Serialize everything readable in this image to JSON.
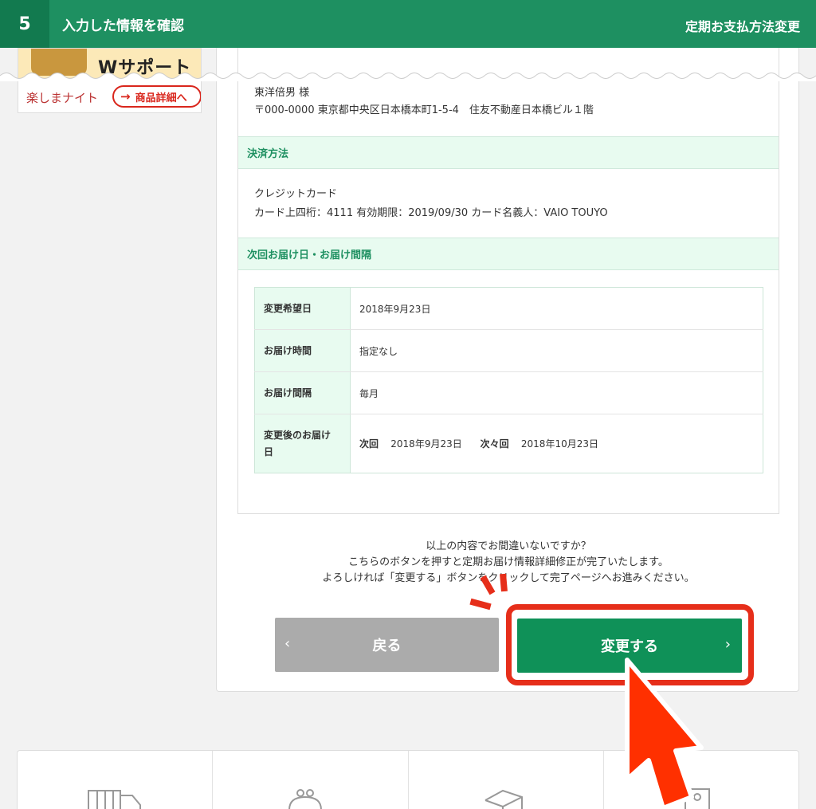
{
  "header": {
    "step_number": "5",
    "step_title": "入力した情報を確認",
    "right_title": "定期お支払方法変更"
  },
  "banner": {
    "headline": "Wサポート",
    "brand": "楽しまナイト",
    "link_label": "商品詳細へ"
  },
  "delivery_address": {
    "name": "東洋倍男 様",
    "address": "〒000-0000 東京都中央区日本橋本町1-5-4　住友不動産日本橋ビル１階"
  },
  "payment": {
    "section_title": "決済方法",
    "method": "クレジットカード",
    "card_info": "カード上四桁：4111 有効期限：2019/09/30 カード名義人：VAIO TOUYO"
  },
  "schedule": {
    "section_title": "次回お届け日・お届け間隔",
    "rows": [
      {
        "label": "変更希望日",
        "value": "2018年9月23日"
      },
      {
        "label": "お届け時間",
        "value": "指定なし"
      },
      {
        "label": "お届け間隔",
        "value": "毎月"
      }
    ],
    "after_change": {
      "label_line1": "変更後のお届け",
      "label_line2": "日",
      "next_label": "次回",
      "next_date": "2018年9月23日",
      "after_next_label": "次々回",
      "after_next_date": "2018年10月23日"
    }
  },
  "confirm": {
    "line1": "以上の内容でお間違いないですか？",
    "line2": "こちらのボタンを押すと定期お届け情報詳細修正が完了いたします。",
    "line3": "よろしければ「変更する」ボタンをクリックして完了ページへお進みください。"
  },
  "buttons": {
    "back_label": "戻る",
    "back_chevron": "‹",
    "submit_label": "変更する",
    "submit_chevron": "›"
  },
  "bottom_nav": {
    "icons": [
      "truck-icon",
      "purse-icon",
      "box-icon",
      "person-icon"
    ]
  },
  "colors": {
    "brand_green": "#1e9061",
    "button_green": "#0f9158",
    "highlight_red": "#e62e1a",
    "section_bg": "#e8fbf0"
  }
}
